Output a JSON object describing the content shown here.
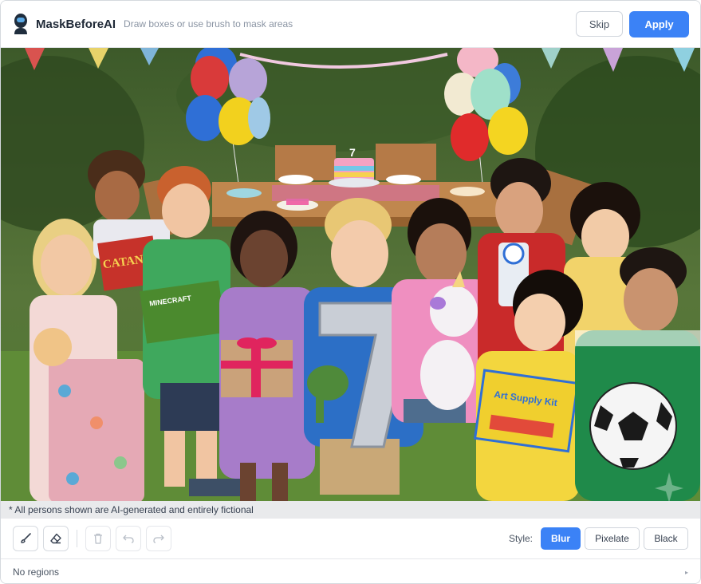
{
  "header": {
    "app_title": "MaskBeforeAI",
    "subtitle": "Draw boxes or use brush to mask areas",
    "skip_label": "Skip",
    "apply_label": "Apply"
  },
  "image": {
    "description_icon": "party-photo",
    "cake_number": "7",
    "catan_box_text": "CATAN",
    "art_kit_text": "Art Supply Kit",
    "minecraft_text": "MINECRAFT"
  },
  "disclaimer": "* All persons shown are AI-generated and entirely fictional",
  "toolbar": {
    "tools": [
      {
        "name": "brush-icon",
        "label": "Brush"
      },
      {
        "name": "eraser-icon",
        "label": "Eraser"
      },
      {
        "name": "trash-icon",
        "label": "Delete"
      },
      {
        "name": "undo-icon",
        "label": "Undo"
      },
      {
        "name": "redo-icon",
        "label": "Redo"
      }
    ],
    "style_label": "Style:",
    "styles": [
      "Blur",
      "Pixelate",
      "Black"
    ],
    "active_style": "Blur"
  },
  "status": {
    "regions_text": "No regions",
    "caret_icon": "chevron-right-icon"
  },
  "colors": {
    "accent": "#3b82f6",
    "header_bg": "#ffffff",
    "disclaimer_bg": "#e9eaec"
  }
}
